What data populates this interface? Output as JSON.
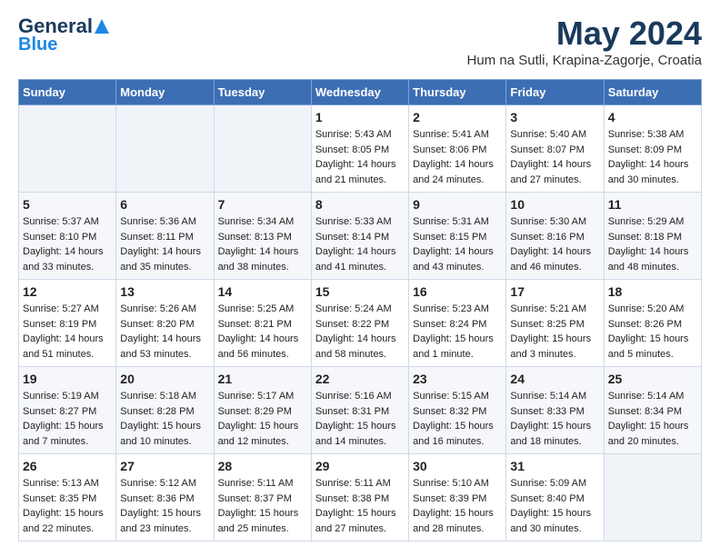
{
  "header": {
    "logo_line1": "General",
    "logo_line2": "Blue",
    "month_year": "May 2024",
    "location": "Hum na Sutli, Krapina-Zagorje, Croatia"
  },
  "days_of_week": [
    "Sunday",
    "Monday",
    "Tuesday",
    "Wednesday",
    "Thursday",
    "Friday",
    "Saturday"
  ],
  "weeks": [
    [
      {
        "day": "",
        "info": ""
      },
      {
        "day": "",
        "info": ""
      },
      {
        "day": "",
        "info": ""
      },
      {
        "day": "1",
        "info": "Sunrise: 5:43 AM\nSunset: 8:05 PM\nDaylight: 14 hours\nand 21 minutes."
      },
      {
        "day": "2",
        "info": "Sunrise: 5:41 AM\nSunset: 8:06 PM\nDaylight: 14 hours\nand 24 minutes."
      },
      {
        "day": "3",
        "info": "Sunrise: 5:40 AM\nSunset: 8:07 PM\nDaylight: 14 hours\nand 27 minutes."
      },
      {
        "day": "4",
        "info": "Sunrise: 5:38 AM\nSunset: 8:09 PM\nDaylight: 14 hours\nand 30 minutes."
      }
    ],
    [
      {
        "day": "5",
        "info": "Sunrise: 5:37 AM\nSunset: 8:10 PM\nDaylight: 14 hours\nand 33 minutes."
      },
      {
        "day": "6",
        "info": "Sunrise: 5:36 AM\nSunset: 8:11 PM\nDaylight: 14 hours\nand 35 minutes."
      },
      {
        "day": "7",
        "info": "Sunrise: 5:34 AM\nSunset: 8:13 PM\nDaylight: 14 hours\nand 38 minutes."
      },
      {
        "day": "8",
        "info": "Sunrise: 5:33 AM\nSunset: 8:14 PM\nDaylight: 14 hours\nand 41 minutes."
      },
      {
        "day": "9",
        "info": "Sunrise: 5:31 AM\nSunset: 8:15 PM\nDaylight: 14 hours\nand 43 minutes."
      },
      {
        "day": "10",
        "info": "Sunrise: 5:30 AM\nSunset: 8:16 PM\nDaylight: 14 hours\nand 46 minutes."
      },
      {
        "day": "11",
        "info": "Sunrise: 5:29 AM\nSunset: 8:18 PM\nDaylight: 14 hours\nand 48 minutes."
      }
    ],
    [
      {
        "day": "12",
        "info": "Sunrise: 5:27 AM\nSunset: 8:19 PM\nDaylight: 14 hours\nand 51 minutes."
      },
      {
        "day": "13",
        "info": "Sunrise: 5:26 AM\nSunset: 8:20 PM\nDaylight: 14 hours\nand 53 minutes."
      },
      {
        "day": "14",
        "info": "Sunrise: 5:25 AM\nSunset: 8:21 PM\nDaylight: 14 hours\nand 56 minutes."
      },
      {
        "day": "15",
        "info": "Sunrise: 5:24 AM\nSunset: 8:22 PM\nDaylight: 14 hours\nand 58 minutes."
      },
      {
        "day": "16",
        "info": "Sunrise: 5:23 AM\nSunset: 8:24 PM\nDaylight: 15 hours\nand 1 minute."
      },
      {
        "day": "17",
        "info": "Sunrise: 5:21 AM\nSunset: 8:25 PM\nDaylight: 15 hours\nand 3 minutes."
      },
      {
        "day": "18",
        "info": "Sunrise: 5:20 AM\nSunset: 8:26 PM\nDaylight: 15 hours\nand 5 minutes."
      }
    ],
    [
      {
        "day": "19",
        "info": "Sunrise: 5:19 AM\nSunset: 8:27 PM\nDaylight: 15 hours\nand 7 minutes."
      },
      {
        "day": "20",
        "info": "Sunrise: 5:18 AM\nSunset: 8:28 PM\nDaylight: 15 hours\nand 10 minutes."
      },
      {
        "day": "21",
        "info": "Sunrise: 5:17 AM\nSunset: 8:29 PM\nDaylight: 15 hours\nand 12 minutes."
      },
      {
        "day": "22",
        "info": "Sunrise: 5:16 AM\nSunset: 8:31 PM\nDaylight: 15 hours\nand 14 minutes."
      },
      {
        "day": "23",
        "info": "Sunrise: 5:15 AM\nSunset: 8:32 PM\nDaylight: 15 hours\nand 16 minutes."
      },
      {
        "day": "24",
        "info": "Sunrise: 5:14 AM\nSunset: 8:33 PM\nDaylight: 15 hours\nand 18 minutes."
      },
      {
        "day": "25",
        "info": "Sunrise: 5:14 AM\nSunset: 8:34 PM\nDaylight: 15 hours\nand 20 minutes."
      }
    ],
    [
      {
        "day": "26",
        "info": "Sunrise: 5:13 AM\nSunset: 8:35 PM\nDaylight: 15 hours\nand 22 minutes."
      },
      {
        "day": "27",
        "info": "Sunrise: 5:12 AM\nSunset: 8:36 PM\nDaylight: 15 hours\nand 23 minutes."
      },
      {
        "day": "28",
        "info": "Sunrise: 5:11 AM\nSunset: 8:37 PM\nDaylight: 15 hours\nand 25 minutes."
      },
      {
        "day": "29",
        "info": "Sunrise: 5:11 AM\nSunset: 8:38 PM\nDaylight: 15 hours\nand 27 minutes."
      },
      {
        "day": "30",
        "info": "Sunrise: 5:10 AM\nSunset: 8:39 PM\nDaylight: 15 hours\nand 28 minutes."
      },
      {
        "day": "31",
        "info": "Sunrise: 5:09 AM\nSunset: 8:40 PM\nDaylight: 15 hours\nand 30 minutes."
      },
      {
        "day": "",
        "info": ""
      }
    ]
  ]
}
